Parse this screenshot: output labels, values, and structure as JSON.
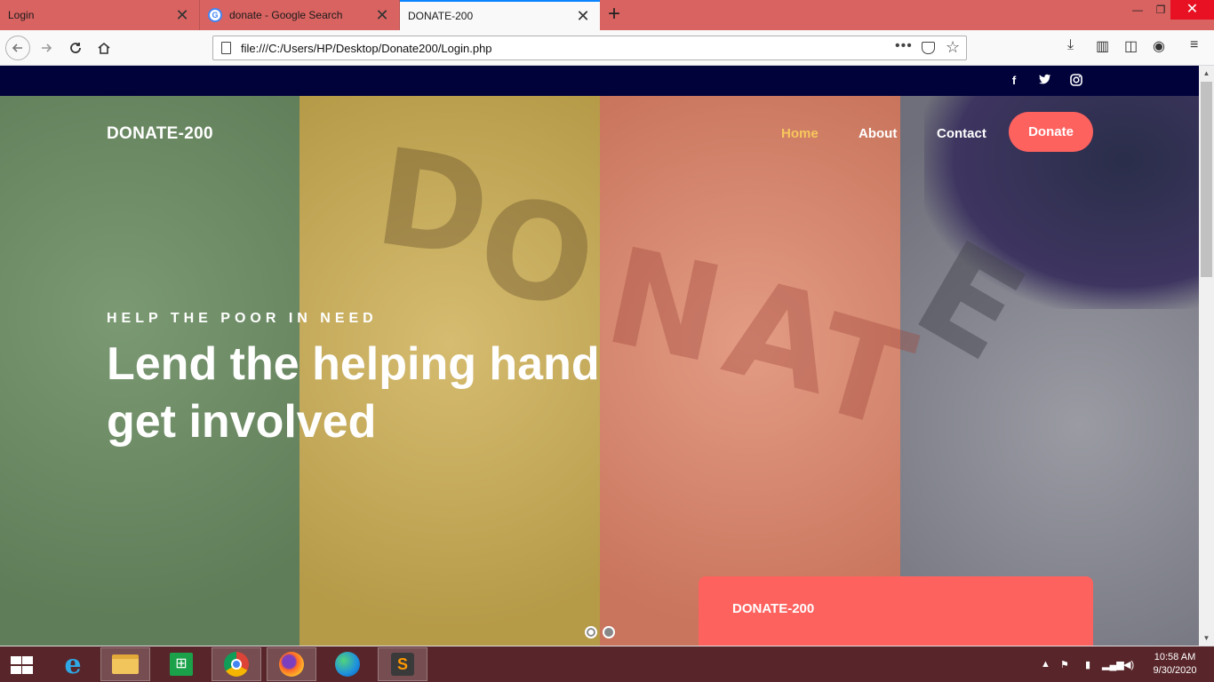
{
  "browser": {
    "tabs": [
      {
        "title": "Login",
        "active": false
      },
      {
        "title": "donate - Google Search",
        "active": false
      },
      {
        "title": "DONATE-200",
        "active": true
      }
    ],
    "url": "file:///C:/Users/HP/Desktop/Donate200/Login.php",
    "accent_color": "#0a84ff",
    "tabstrip_color": "#d96361"
  },
  "site": {
    "social": [
      "facebook-icon",
      "twitter-icon",
      "instagram-icon"
    ],
    "brand": "DONATE-200",
    "menu": [
      {
        "label": "Home",
        "current": true
      },
      {
        "label": "About",
        "current": false
      },
      {
        "label": "Contact",
        "current": false
      }
    ],
    "donate_button": "Donate",
    "hero": {
      "tagline": "HELP THE POOR IN NEED",
      "headline_line1": "Lend the helping hand",
      "headline_line2": "get involved",
      "background_word": "DONATE"
    },
    "card_title": "DONATE-200",
    "slider": {
      "active_index": 0,
      "count": 2
    },
    "colors": {
      "topbar": "#01023a",
      "accent": "#fe625f",
      "menu_current": "#f7c75c"
    }
  },
  "taskbar": {
    "apps": [
      "internet-explorer-icon",
      "file-explorer-icon",
      "store-icon",
      "chrome-icon",
      "firefox-icon",
      "edge-icon",
      "sublime-text-icon"
    ],
    "clock_time": "10:58 AM",
    "clock_date": "9/30/2020"
  }
}
